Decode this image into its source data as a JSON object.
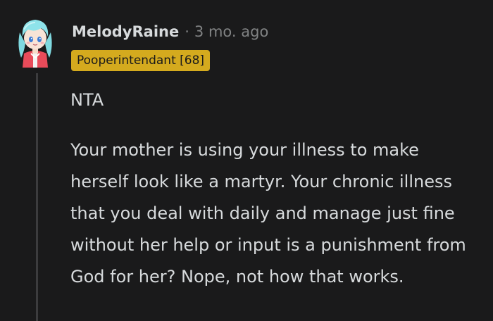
{
  "comment": {
    "username": "MelodyRaine",
    "separator": "·",
    "timestamp": "3 mo. ago",
    "flair": "Pooperintendant [68]",
    "flair_color": "#d4aa1e",
    "paragraphs": [
      "NTA",
      "Your mother is using your illness to make herself look like a martyr. Your chronic illness that you deal with daily and manage just fine without her help or input is a punishment from God for her? Nope, not how that works."
    ]
  },
  "colors": {
    "background": "#1a1a1b",
    "text": "#d7dadc",
    "muted": "#818384",
    "thread_line": "#3c3c3e"
  }
}
